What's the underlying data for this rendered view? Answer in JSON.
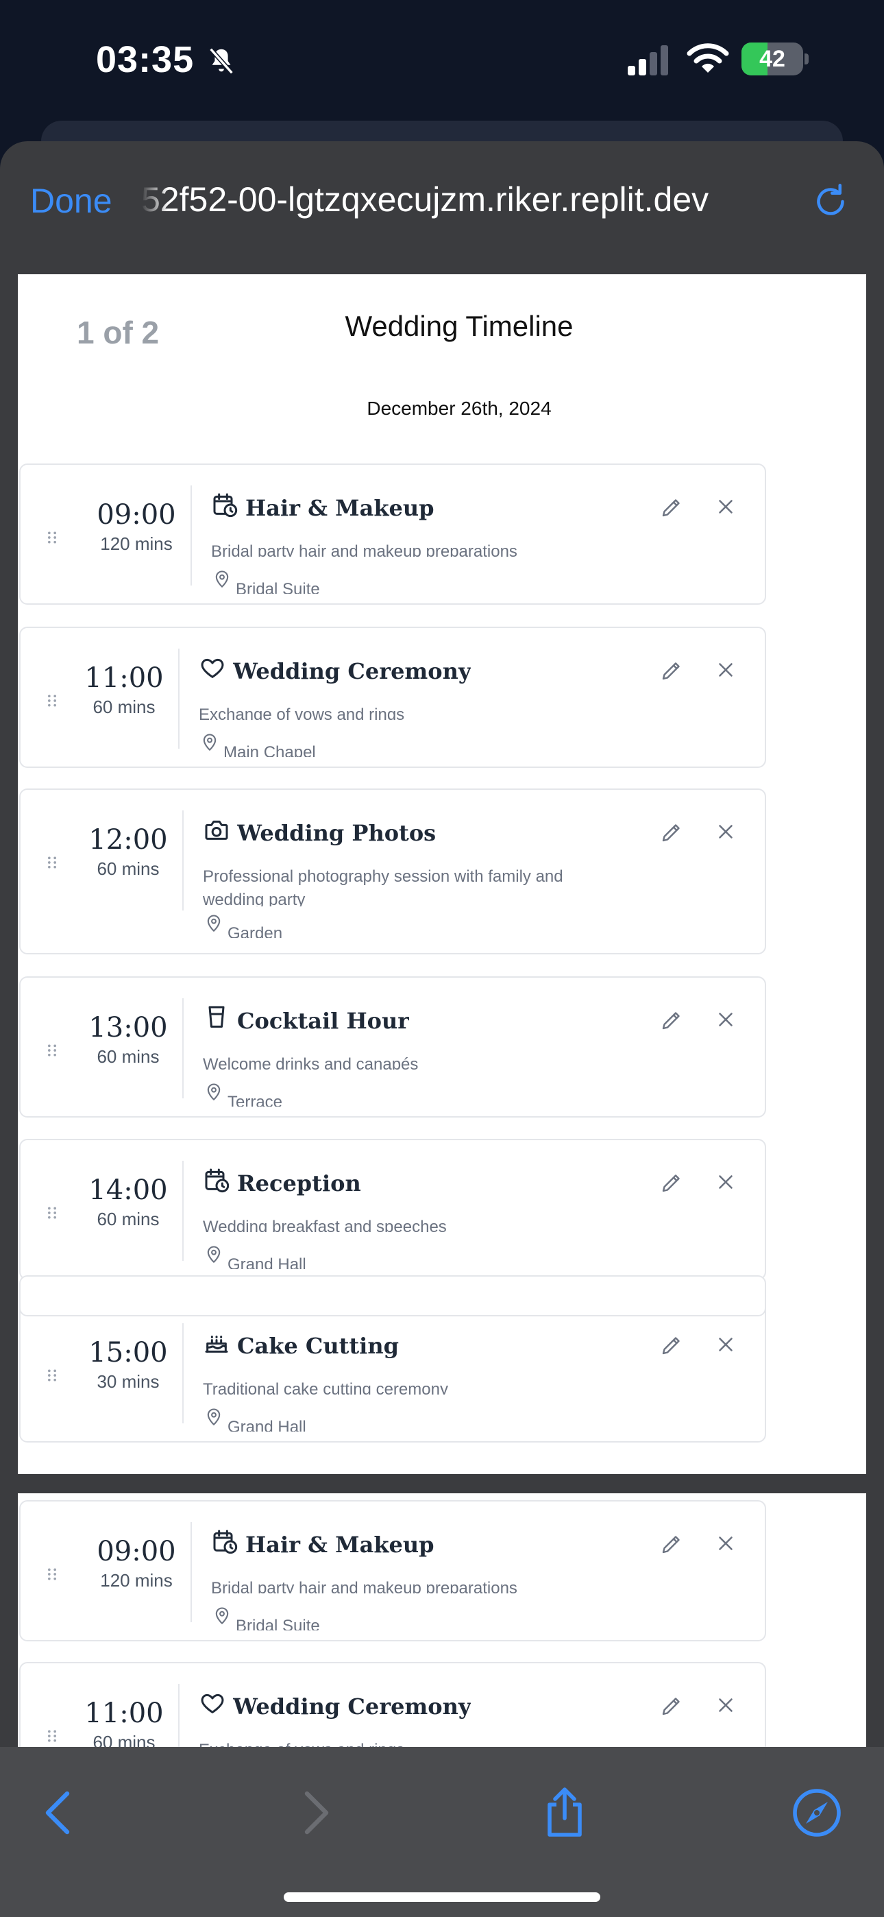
{
  "status_bar": {
    "time": "03:35",
    "battery": "42",
    "battery_level": 0.42
  },
  "browser": {
    "done_label": "Done",
    "url": "52f52-00-lgtzqxecujzm.riker.replit.dev"
  },
  "page": {
    "counter": "1 of 2",
    "title": "Wedding Timeline",
    "date": "December 26th, 2024"
  },
  "events": [
    {
      "time": "09:00",
      "duration": "120 mins",
      "icon": "calendar-clock-icon",
      "title": "Hair & Makeup",
      "description": "Bridal party hair and makeup preparations",
      "location": "Bridal Suite"
    },
    {
      "time": "11:00",
      "duration": "60 mins",
      "icon": "heart-icon",
      "title": "Wedding Ceremony",
      "description": "Exchange of vows and rings",
      "location": "Main Chapel"
    },
    {
      "time": "12:00",
      "duration": "60 mins",
      "icon": "camera-icon",
      "title": "Wedding Photos",
      "description": "Professional photography session with family and wedding party",
      "location": "Garden"
    },
    {
      "time": "13:00",
      "duration": "60 mins",
      "icon": "glass-icon",
      "title": "Cocktail Hour",
      "description": "Welcome drinks and canapés",
      "location": "Terrace"
    },
    {
      "time": "14:00",
      "duration": "60 mins",
      "icon": "calendar-clock-icon",
      "title": "Reception",
      "description": "Wedding breakfast and speeches",
      "location": "Grand Hall"
    },
    {
      "time": "15:00",
      "duration": "30 mins",
      "icon": "cake-icon",
      "title": "Cake Cutting",
      "description": "Traditional cake cutting ceremony",
      "location": "Grand Hall"
    }
  ],
  "colors": {
    "accent": "#3b8cf7",
    "battery_green": "#34c759"
  }
}
